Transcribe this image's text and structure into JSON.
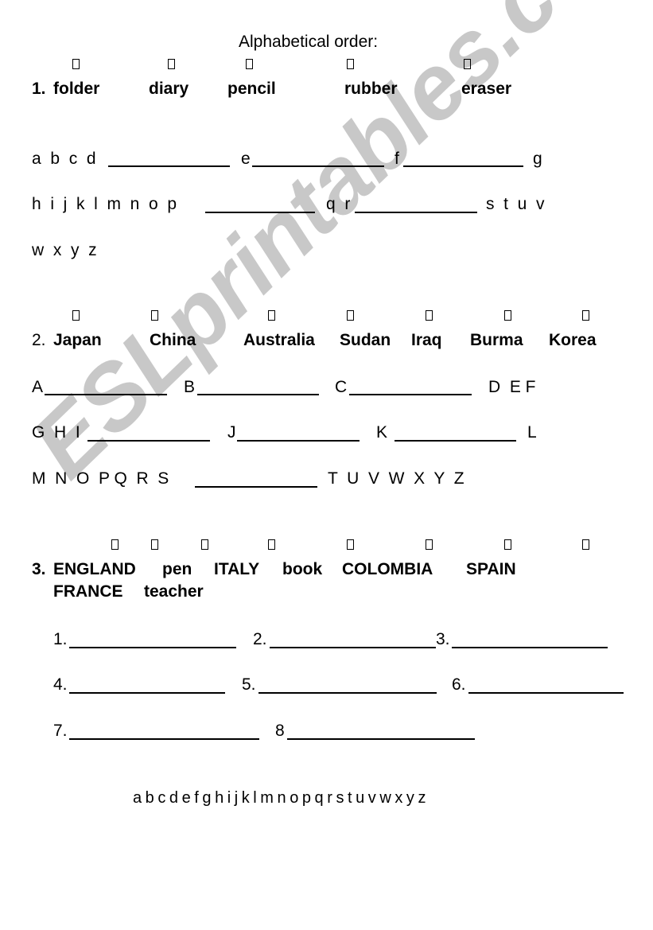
{
  "title": "Alphabetical order:",
  "watermark": "ESLprintables.com",
  "section1": {
    "number": "1.",
    "words": [
      "folder",
      "diary",
      "pencil",
      "rubber",
      "eraser"
    ],
    "row1": [
      "a  b  c  d",
      "e",
      "f",
      "g"
    ],
    "row2": [
      "h  i  j  k  l  m  n  o  p",
      "q  r",
      "s  t  u  v"
    ],
    "row3": [
      "w  x  y  z"
    ]
  },
  "section2": {
    "number": "2.",
    "words": [
      "Japan",
      "China",
      "Australia",
      "Sudan",
      "Iraq",
      "Burma",
      "Korea"
    ],
    "row1": [
      "A",
      "B",
      "C",
      "D  E F"
    ],
    "row2": [
      "G  H  I",
      "J",
      "K",
      "L"
    ],
    "row3": [
      "M  N  O  P Q  R  S",
      "T  U  V  W  X  Y  Z"
    ]
  },
  "section3": {
    "number": "3.",
    "line1": [
      "ENGLAND",
      "pen",
      "ITALY",
      "book",
      "COLOMBIA",
      "SPAIN"
    ],
    "line2": [
      "FRANCE",
      "teacher"
    ],
    "answers": [
      "1.",
      "2.",
      "3.",
      "4.",
      "5.",
      "6.",
      "7.",
      "8"
    ]
  },
  "footer_alphabet": "a b c d e f g h i j k l m n o p q r s t u v w x y z"
}
